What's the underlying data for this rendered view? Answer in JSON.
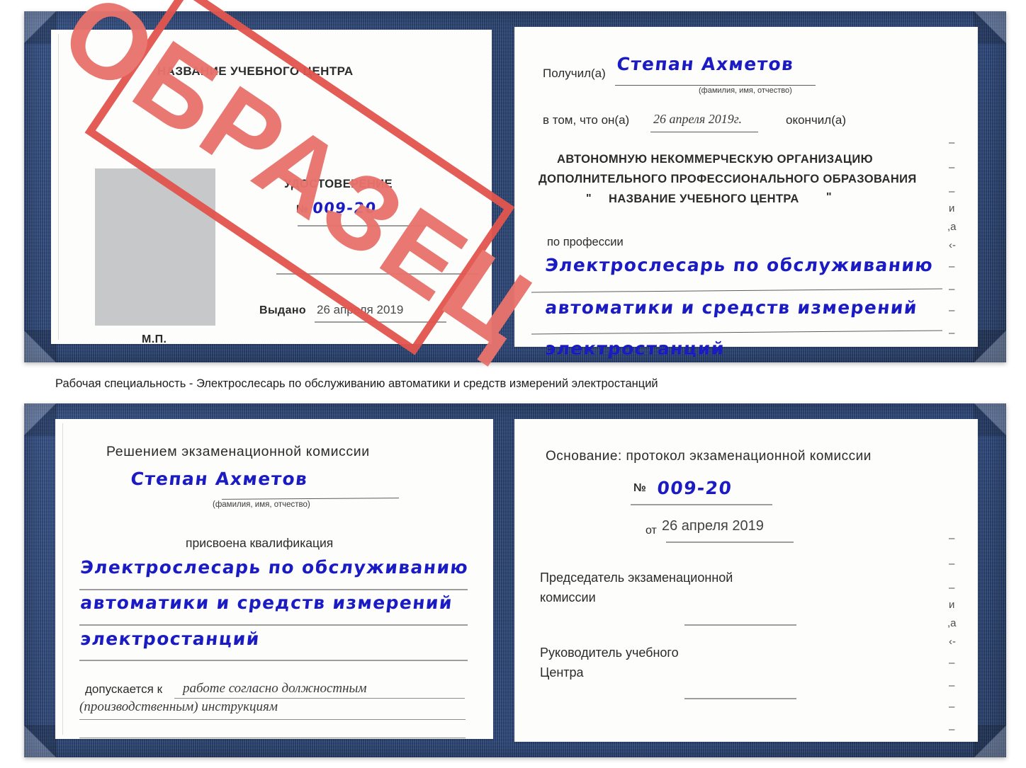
{
  "caption": "Рабочая специальность - Электрослесарь по обслуживанию автоматики и средств измерений электростанций",
  "watermark": {
    "text": "ОБРАЗЕЦ",
    "color": "#e2564f",
    "fill_color": "#e8736c"
  },
  "colors": {
    "cover_blue": "#1e3a6d",
    "handwriting_blue": "#1b1bc4",
    "photo_placeholder_gray": "#c6c8c9",
    "paper_white": "#fdfdfc",
    "rule_gray": "#8d8d8d"
  },
  "certificate_top": {
    "left_page": {
      "center_name": "НАЗВАНИЕ УЧЕБНОГО ЦЕНТРА",
      "doc_type": "УДОСТОВЕРЕНИЕ",
      "number_label": "№",
      "number_value": "009-20",
      "issued_label": "Выдано",
      "issued_date": "26 апреля 2019",
      "seal_label": "М.П."
    },
    "right_page": {
      "received_label": "Получил(а)",
      "received_name": "Степан Ахметов",
      "name_hint": "(фамилия, имя, отчество)",
      "in_that_label": "в том, что он(а)",
      "completion_date": "26 апреля 2019г.",
      "finished_label": "окончил(а)",
      "org_line1": "АВТОНОМНУЮ НЕКОММЕРЧЕСКУЮ ОРГАНИЗАЦИЮ",
      "org_line2": "ДОПОЛНИТЕЛЬНОГО ПРОФЕССИОНАЛЬНОГО ОБРАЗОВАНИЯ",
      "org_quote_open": "\"",
      "org_line3": "НАЗВАНИЕ УЧЕБНОГО ЦЕНТРА",
      "org_quote_close": "\"",
      "profession_label": "по профессии",
      "profession_line1": "Электрослесарь по обслуживанию",
      "profession_line2": "автоматики и средств измерений",
      "profession_line3": "электростанций",
      "edge_fragments": [
        "–",
        "–",
        "–",
        "и",
        ",а",
        "‹-",
        "–",
        "–",
        "–",
        "–"
      ]
    }
  },
  "certificate_bottom": {
    "left_page": {
      "heading": "Решением экзаменационной комиссии",
      "name": "Степан Ахметов",
      "name_hint": "(фамилия, имя, отчество)",
      "qualification_label": "присвоена квалификация",
      "qualification_line1": "Электрослесарь по обслуживанию",
      "qualification_line2": "автоматики и средств измерений",
      "qualification_line3": "электростанций",
      "admitted_label": "допускается к",
      "admitted_line1": "работе согласно должностным",
      "admitted_line2": "(производственным) инструкциям"
    },
    "right_page": {
      "basis_label": "Основание: протокол экзаменационной комиссии",
      "number_label": "№",
      "number_value": "009-20",
      "from_label": "от",
      "from_date": "26 апреля 2019",
      "chairman_line1": "Председатель экзаменационной",
      "chairman_line2": "комиссии",
      "head_line1": "Руководитель учебного",
      "head_line2": "Центра",
      "edge_fragments": [
        "–",
        "–",
        "–",
        "и",
        ",а",
        "‹-",
        "–",
        "–",
        "–",
        "–"
      ]
    }
  }
}
